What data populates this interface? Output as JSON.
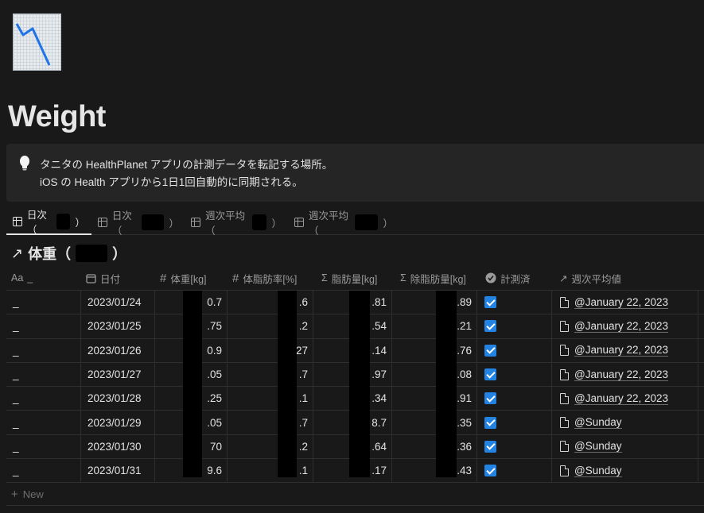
{
  "page": {
    "title": "Weight"
  },
  "callout": {
    "icon": "lightbulb-icon",
    "line1": "タニタの HealthPlanet アプリの計測データを転記する場所。",
    "line2": "iOS の Health アプリから1日1回自動的に同期される。"
  },
  "tabs": [
    {
      "label": "日次（",
      "close": "）",
      "active": true
    },
    {
      "label": "日次（",
      "close": "）",
      "active": false
    },
    {
      "label": "週次平均（",
      "close": "）",
      "active": false
    },
    {
      "label": "週次平均（",
      "close": "）",
      "active": false
    }
  ],
  "database": {
    "arrow": "↗",
    "title": "体重（",
    "title_close": "）"
  },
  "columns": [
    {
      "icon": "Aa",
      "label": "_"
    },
    {
      "icon": "calendar-icon",
      "label": "日付"
    },
    {
      "icon": "#",
      "label": "体重[kg]"
    },
    {
      "icon": "#",
      "label": "体脂肪率[%]"
    },
    {
      "icon": "Σ",
      "label": "脂肪量[kg]"
    },
    {
      "icon": "Σ",
      "label": "除脂肪量[kg]"
    },
    {
      "icon": "check-circle-icon",
      "label": "計測済"
    },
    {
      "icon": "↗",
      "label": "週次平均値"
    }
  ],
  "rows": [
    {
      "name": "_",
      "date": "2023/01/24",
      "weight": "0.7",
      "fat_pct": ".6",
      "fat_mass": ".81",
      "lean_mass": ".89",
      "measured": true,
      "week": "@January 22, 2023"
    },
    {
      "name": "_",
      "date": "2023/01/25",
      "weight": ".75",
      "fat_pct": ".2",
      "fat_mass": ".54",
      "lean_mass": ".21",
      "measured": true,
      "week": "@January 22, 2023"
    },
    {
      "name": "_",
      "date": "2023/01/26",
      "weight": "0.9",
      "fat_pct": "27",
      "fat_mass": ".14",
      "lean_mass": ".76",
      "measured": true,
      "week": "@January 22, 2023"
    },
    {
      "name": "_",
      "date": "2023/01/27",
      "weight": ".05",
      "fat_pct": ".7",
      "fat_mass": ".97",
      "lean_mass": ".08",
      "measured": true,
      "week": "@January 22, 2023"
    },
    {
      "name": "_",
      "date": "2023/01/28",
      "weight": ".25",
      "fat_pct": ".1",
      "fat_mass": ".34",
      "lean_mass": ".91",
      "measured": true,
      "week": "@January 22, 2023"
    },
    {
      "name": "_",
      "date": "2023/01/29",
      "weight": ".05",
      "fat_pct": ".7",
      "fat_mass": "8.7",
      "lean_mass": ".35",
      "measured": true,
      "week": "@Sunday"
    },
    {
      "name": "_",
      "date": "2023/01/30",
      "weight": "70",
      "fat_pct": ".2",
      "fat_mass": ".64",
      "lean_mass": ".36",
      "measured": true,
      "week": "@Sunday"
    },
    {
      "name": "_",
      "date": "2023/01/31",
      "weight": "9.6",
      "fat_pct": ".1",
      "fat_mass": ".17",
      "lean_mass": ".43",
      "measured": true,
      "week": "@Sunday"
    }
  ],
  "new_row": {
    "icon": "+",
    "label": "New"
  },
  "colors": {
    "background": "#191919",
    "accent": "#2383e2",
    "callout": "#252525"
  }
}
